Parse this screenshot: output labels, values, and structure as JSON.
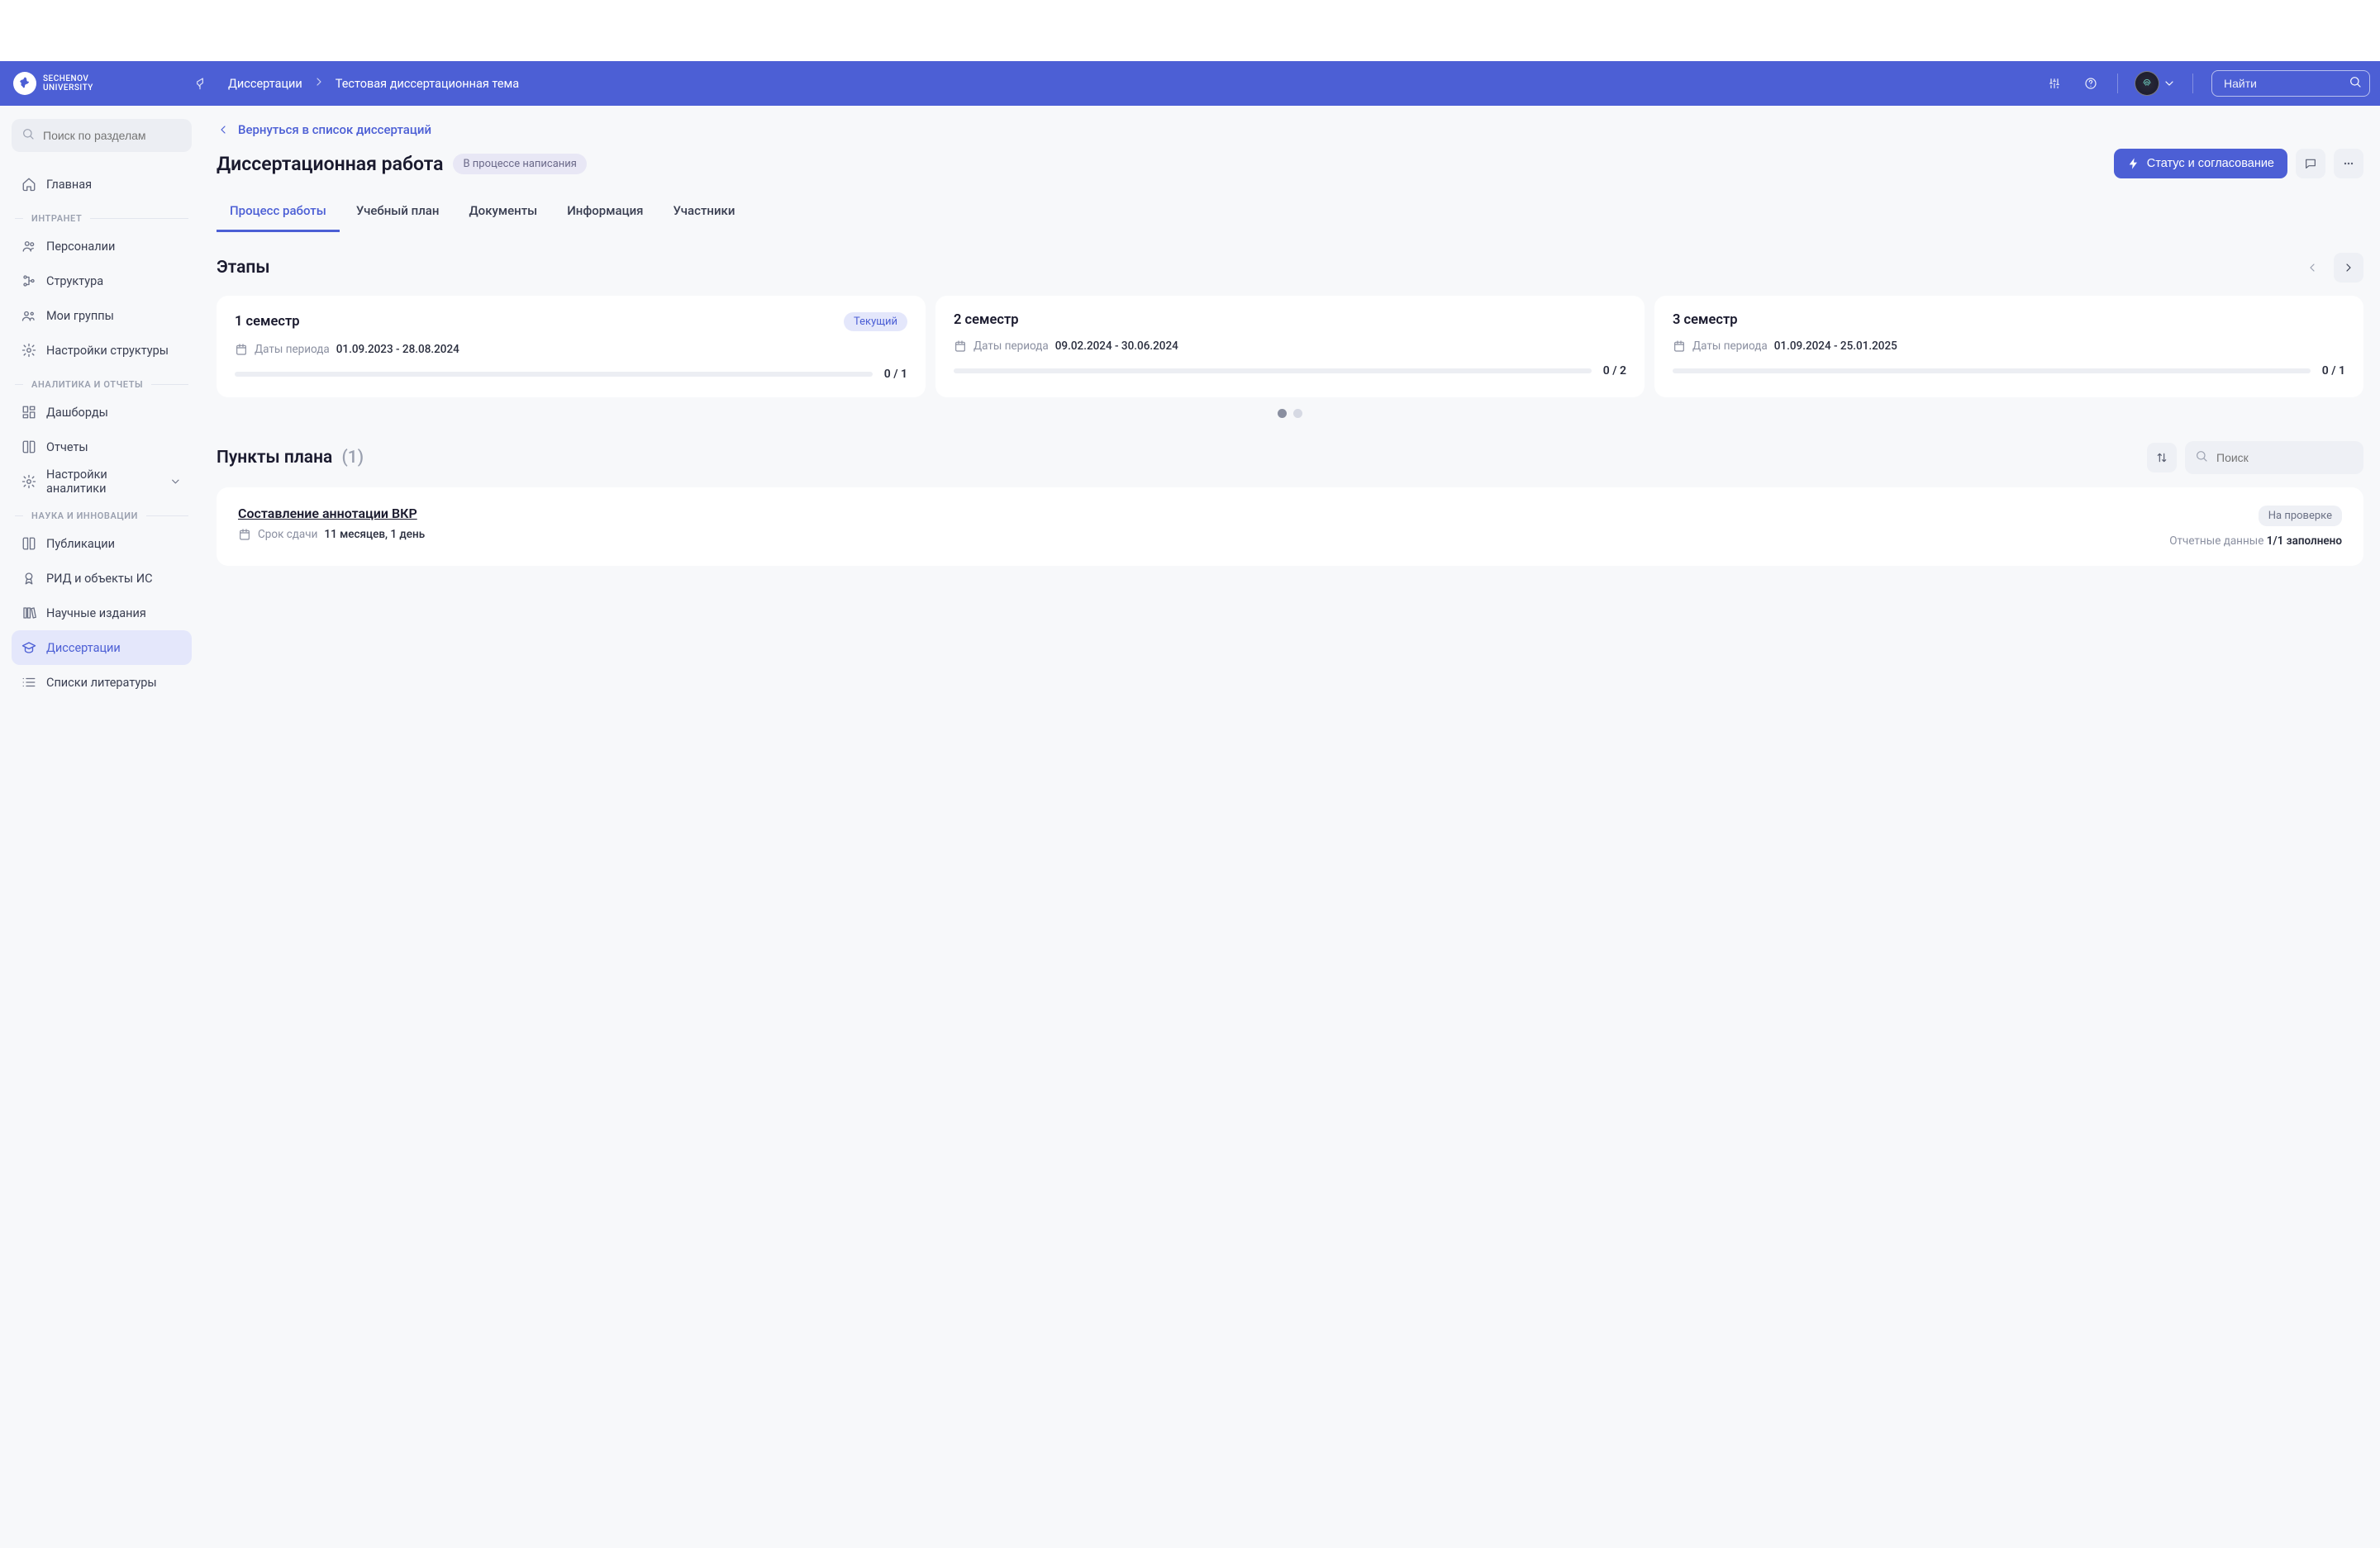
{
  "brand": {
    "line1": "SECHENOV",
    "line2": "UNIVERSITY"
  },
  "breadcrumb": {
    "root": "Диссертации",
    "current": "Тестовая диссертационная тема"
  },
  "global_search_placeholder": "Найти",
  "sidebar": {
    "search_placeholder": "Поиск по разделам",
    "items": [
      {
        "label": "Главная"
      }
    ],
    "groups": [
      {
        "label": "ИНТРАНЕТ",
        "items": [
          "Персоналии",
          "Структура",
          "Мои группы",
          "Настройки структуры"
        ]
      },
      {
        "label": "АНАЛИТИКА И ОТЧЕТЫ",
        "items": [
          "Дашборды",
          "Отчеты",
          "Настройки аналитики"
        ]
      },
      {
        "label": "НАУКА И ИННОВАЦИИ",
        "items": [
          "Публикации",
          "РИД и объекты ИС",
          "Научные издания",
          "Диссертации",
          "Списки литературы"
        ]
      }
    ]
  },
  "back_link": "Вернуться в список диссертаций",
  "page_title": "Диссертационная работа",
  "page_status": "В процессе написания",
  "primary_action": "Статус и согласование",
  "tabs": [
    "Процесс работы",
    "Учебный план",
    "Документы",
    "Информация",
    "Участники"
  ],
  "stages_title": "Этапы",
  "current_chip": "Текущий",
  "dates_label": "Даты периода",
  "stages": [
    {
      "name": "1 семестр",
      "current": true,
      "dates": "01.09.2023 - 28.08.2024",
      "done": 0,
      "total": 1,
      "fill": 0
    },
    {
      "name": "2 семестр",
      "current": false,
      "dates": "09.02.2024 - 30.06.2024",
      "done": 0,
      "total": 2,
      "fill": 0
    },
    {
      "name": "3 семестр",
      "current": false,
      "dates": "01.09.2024 - 25.01.2025",
      "done": 0,
      "total": 1,
      "fill": 0
    }
  ],
  "plan": {
    "title": "Пункты плана",
    "count": "(1)",
    "search_placeholder": "Поиск",
    "items": [
      {
        "name": "Составление аннотации ВКР",
        "due_label": "Срок сдачи",
        "due_value": "11 месяцев, 1 день",
        "review": "На проверке",
        "report_label": "Отчетные данные",
        "report_value": "1/1 заполнено"
      }
    ]
  }
}
